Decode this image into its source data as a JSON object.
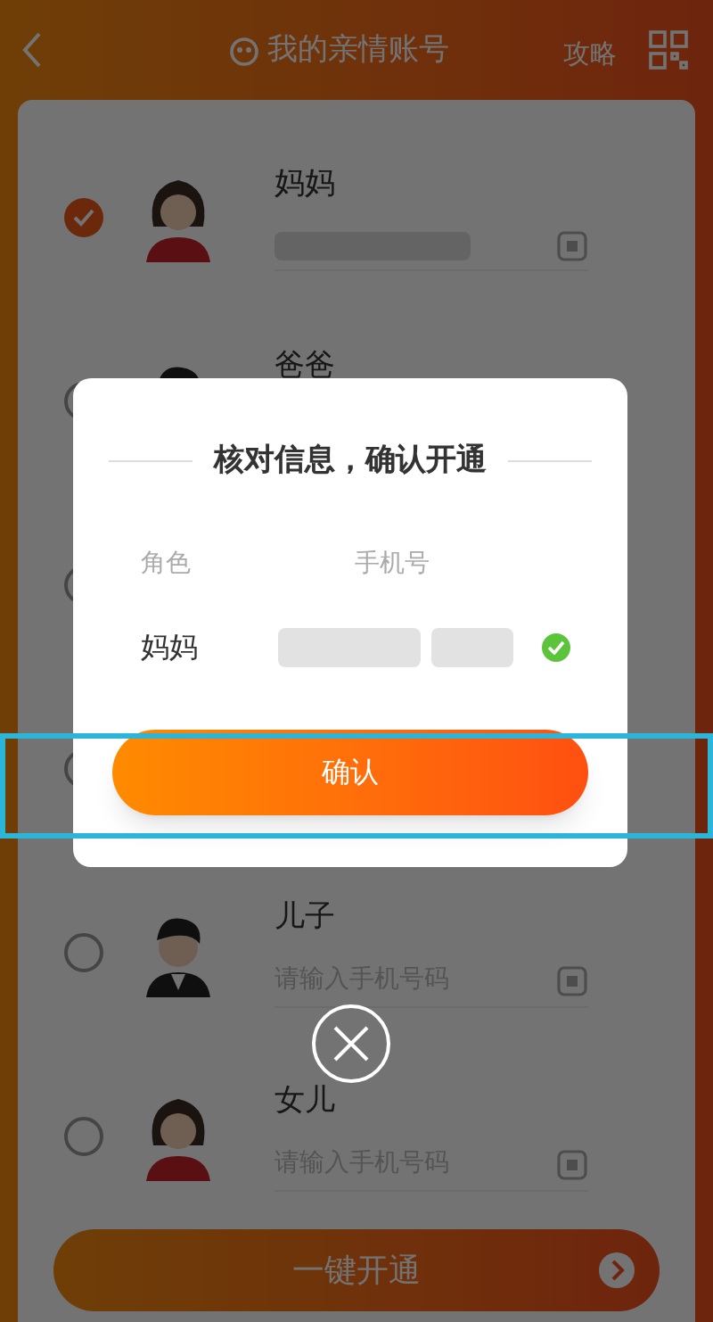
{
  "header": {
    "title": "我的亲情账号",
    "link": "攻略"
  },
  "members": [
    {
      "kind": "woman",
      "name": "妈妈",
      "checked": true,
      "phone_masked": true
    },
    {
      "kind": "man",
      "name": "爸爸",
      "checked": false
    },
    {
      "kind": "covered",
      "checked": false
    },
    {
      "kind": "covered",
      "checked": false
    },
    {
      "kind": "man",
      "name": "儿子",
      "checked": false,
      "phone_masked": false,
      "placeholder": "请输入手机号码"
    },
    {
      "kind": "woman",
      "name": "女儿",
      "checked": false,
      "phone_masked": false,
      "placeholder": "请输入手机号码"
    }
  ],
  "open_button": "一键开通",
  "dialog": {
    "title": "核对信息，确认开通",
    "columns": [
      "角色",
      "手机号"
    ],
    "role": "妈妈",
    "verified": true,
    "confirm": "确认"
  }
}
